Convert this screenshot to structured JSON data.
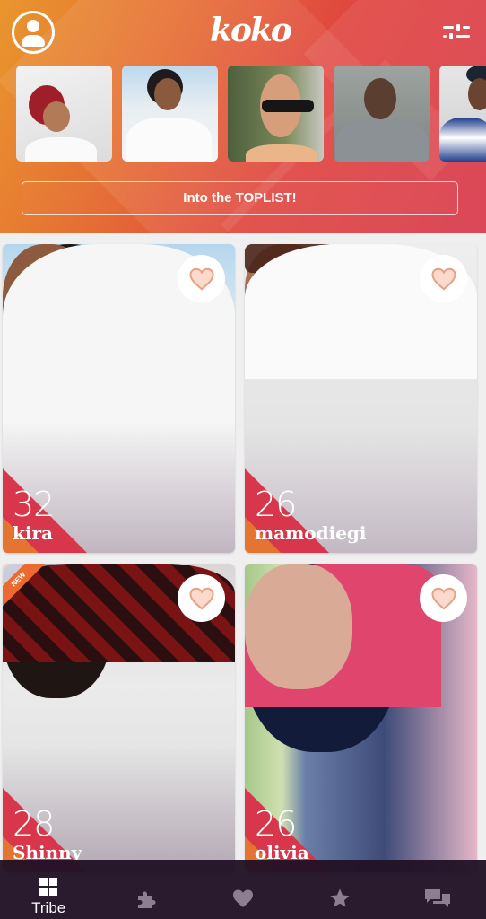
{
  "app": {
    "logo_text": "koko"
  },
  "header": {
    "profile_icon": "user-circle-icon",
    "filter_icon": "sliders-icon",
    "toplist_button": "Into the TOPLIST!"
  },
  "stories": [
    {
      "label": "woman with red turban and sunglasses"
    },
    {
      "label": "woman in white shirt"
    },
    {
      "label": "man with sunglasses"
    },
    {
      "label": "man in grey shirt"
    },
    {
      "label": "man with cap"
    }
  ],
  "cards": [
    {
      "age": "32",
      "name": "kira",
      "badge": "",
      "like_icon": "heart-icon"
    },
    {
      "age": "26",
      "name": "mamodiegi",
      "badge": "",
      "like_icon": "heart-icon"
    },
    {
      "age": "28",
      "name": "Shinny",
      "badge": "NEW",
      "like_icon": "heart-icon"
    },
    {
      "age": "26",
      "name": "olivia",
      "badge": "",
      "like_icon": "heart-icon"
    }
  ],
  "colors": {
    "accent": "#e04640",
    "heart_fill": "#fbd9cc",
    "heart_stroke": "#e9a184",
    "nav_bg": "#221226",
    "nav_icon_inactive": "#8e7e90"
  },
  "bottom_nav": [
    {
      "label": "Tribe",
      "icon": "grid-icon",
      "active": true
    },
    {
      "label": "",
      "icon": "puzzle-icon",
      "active": false
    },
    {
      "label": "",
      "icon": "heart-icon",
      "active": false
    },
    {
      "label": "",
      "icon": "star-icon",
      "active": false
    },
    {
      "label": "",
      "icon": "chat-icon",
      "active": false
    }
  ]
}
